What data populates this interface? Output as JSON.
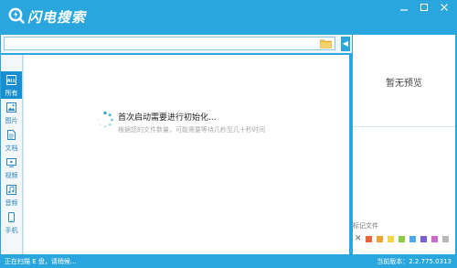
{
  "app": {
    "title": "闪电搜索"
  },
  "search": {
    "value": "",
    "placeholder": ""
  },
  "categories": [
    {
      "label": "所有",
      "icon": "all-icon",
      "active": true
    },
    {
      "label": "图片",
      "icon": "image-icon"
    },
    {
      "label": "文档",
      "icon": "document-icon"
    },
    {
      "label": "视频",
      "icon": "video-icon"
    },
    {
      "label": "音频",
      "icon": "audio-icon"
    },
    {
      "label": "手机",
      "icon": "phone-icon"
    }
  ],
  "all_icon_text": "ALL",
  "main": {
    "message": "首次启动需要进行初始化...",
    "submessage": "根据您的文件数量，可能需要等待几秒至几十秒时间"
  },
  "preview": {
    "text": "暂无预览"
  },
  "tags": {
    "label": "标记文件",
    "colors": [
      "#e8643b",
      "#f0a334",
      "#f3d54a",
      "#8ecb45",
      "#4fa9e8",
      "#7a5fcf",
      "#c86cc7",
      "#b8b8b8"
    ]
  },
  "status": {
    "left": "正在扫描 E 盘，请稍候...",
    "right": "当前版本：2.2.775.0313"
  },
  "colors": {
    "accent": "#29a6de",
    "active_tab": "#1a8fcf"
  }
}
